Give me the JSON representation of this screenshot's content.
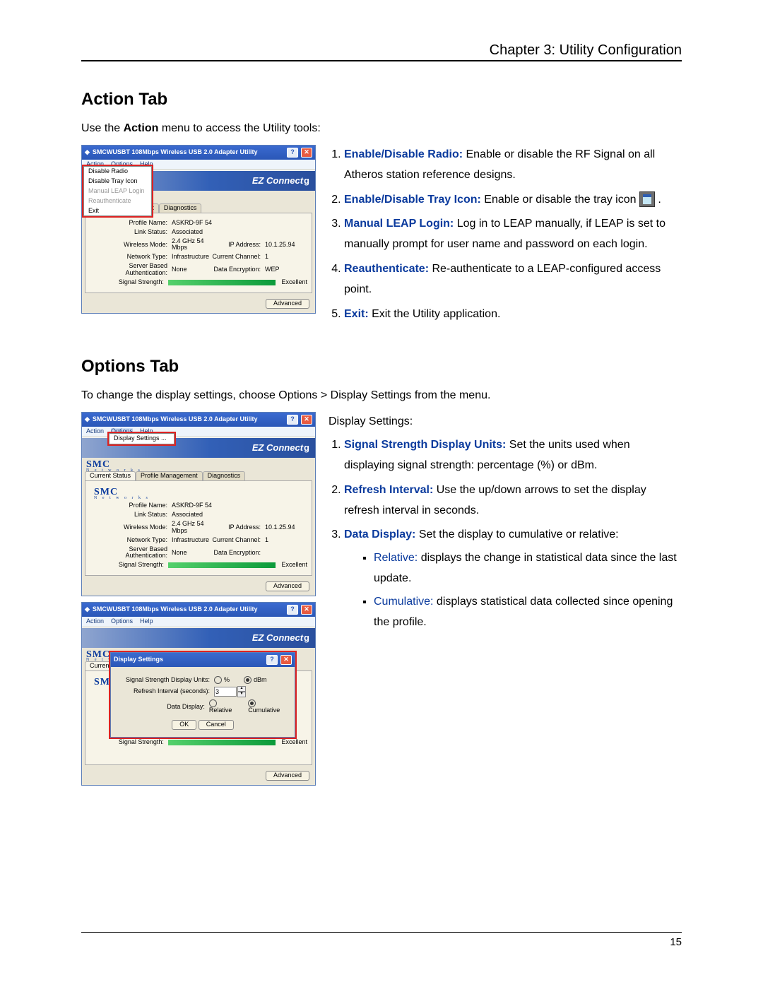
{
  "header": {
    "chapter": "Chapter 3: Utility Configuration"
  },
  "page_number": "15",
  "section1": {
    "title": "Action Tab",
    "intro_prefix": "Use the ",
    "intro_bold": "Action",
    "intro_suffix": " menu to access the Utility tools:"
  },
  "action_items": [
    {
      "term": "Enable/Disable Radio:",
      "text": " Enable or disable the RF Signal on all Atheros station reference designs."
    },
    {
      "term": "Enable/Disable Tray Icon:",
      "text": " Enable or disable the tray icon "
    },
    {
      "term": "Manual LEAP Login:",
      "text": " Log in to LEAP manually, if LEAP is set to manually prompt for user name and password on each login."
    },
    {
      "term": "Reauthenticate:",
      "text": " Re-authenticate to a LEAP-configured access point."
    },
    {
      "term": "Exit:",
      "text": " Exit the Utility application."
    }
  ],
  "section2": {
    "title": "Options Tab",
    "intro": "To change the display settings, choose Options > Display Settings from the menu.",
    "lead": "Display Settings:"
  },
  "options_items": [
    {
      "term": "Signal Strength Display Units:",
      "text": " Set the units used when displaying signal strength: percentage (%) or dBm."
    },
    {
      "term": "Refresh Interval:",
      "text": " Use the up/down arrows to set the display refresh interval in seconds."
    },
    {
      "term": "Data Display:",
      "text": " Set the display to cumulative or relative:"
    }
  ],
  "sub_items": [
    {
      "term": "Relative:",
      "text": " displays the change in statistical data since the last update."
    },
    {
      "term": "Cumulative:",
      "text": " displays statistical data collected since opening the profile."
    }
  ],
  "app": {
    "title": "SMCWUSBT 108Mbps Wireless USB 2.0 Adapter Utility",
    "menus": {
      "action": "Action",
      "options": "Options",
      "help": "Help"
    },
    "brand": "EZ Connect",
    "brand_g": "g",
    "smc": "SMC",
    "smc_sub": "N e t w o r k s",
    "tabs": {
      "current": "Current Status",
      "profile": "Profile Management",
      "diag": "Diagnostics"
    },
    "fields": {
      "profile_name_k": "Profile Name:",
      "profile_name_v": "ASKRD-9F 54",
      "link_status_k": "Link Status:",
      "link_status_v": "Associated",
      "wmode_k": "Wireless Mode:",
      "wmode_v": "2.4 GHz 54 Mbps",
      "ip_k": "IP Address:",
      "ip_v": "10.1.25.94",
      "ntype_k": "Network Type:",
      "ntype_v": "Infrastructure",
      "chan_k": "Current Channel:",
      "chan_v": "1",
      "auth_k": "Server Based Authentication:",
      "auth_v": "None",
      "enc_k": "Data Encryption:",
      "enc_v": "WEP",
      "sig_k": "Signal Strength:",
      "sig_v": "Excellent"
    },
    "advanced": "Advanced",
    "action_menu": {
      "disable_radio": "Disable Radio",
      "disable_tray": "Disable Tray Icon",
      "leap": "Manual LEAP Login",
      "reauth": "Reauthenticate",
      "exit": "Exit"
    },
    "options_menu": {
      "display_settings": "Display Settings ..."
    },
    "ds_dialog": {
      "title": "Display Settings",
      "units_k": "Signal Strength Display Units:",
      "units_pct": "%",
      "units_dbm": "dBm",
      "refresh_k": "Refresh Interval (seconds):",
      "refresh_v": "3",
      "data_k": "Data Display:",
      "data_rel": "Relative",
      "data_cum": "Cumulative",
      "ok": "OK",
      "cancel": "Cancel"
    },
    "tabs_short": {
      "mgmt": "nagement"
    }
  }
}
